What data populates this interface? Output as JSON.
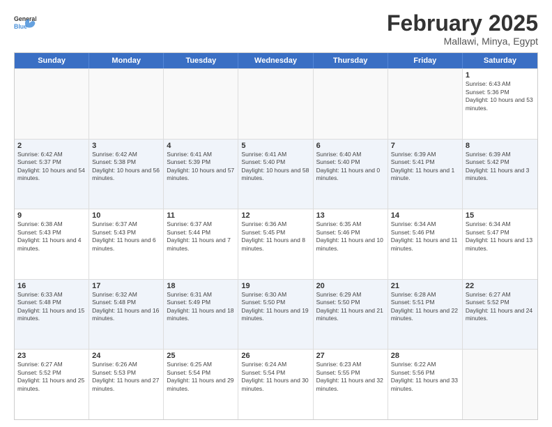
{
  "header": {
    "logo_general": "General",
    "logo_blue": "Blue",
    "title": "February 2025",
    "subtitle": "Mallawi, Minya, Egypt"
  },
  "days_of_week": [
    "Sunday",
    "Monday",
    "Tuesday",
    "Wednesday",
    "Thursday",
    "Friday",
    "Saturday"
  ],
  "weeks": [
    [
      {
        "day": "",
        "empty": true
      },
      {
        "day": "",
        "empty": true
      },
      {
        "day": "",
        "empty": true
      },
      {
        "day": "",
        "empty": true
      },
      {
        "day": "",
        "empty": true
      },
      {
        "day": "",
        "empty": true
      },
      {
        "day": "1",
        "sunrise": "Sunrise: 6:43 AM",
        "sunset": "Sunset: 5:36 PM",
        "daylight": "Daylight: 10 hours and 53 minutes."
      }
    ],
    [
      {
        "day": "2",
        "sunrise": "Sunrise: 6:42 AM",
        "sunset": "Sunset: 5:37 PM",
        "daylight": "Daylight: 10 hours and 54 minutes."
      },
      {
        "day": "3",
        "sunrise": "Sunrise: 6:42 AM",
        "sunset": "Sunset: 5:38 PM",
        "daylight": "Daylight: 10 hours and 56 minutes."
      },
      {
        "day": "4",
        "sunrise": "Sunrise: 6:41 AM",
        "sunset": "Sunset: 5:39 PM",
        "daylight": "Daylight: 10 hours and 57 minutes."
      },
      {
        "day": "5",
        "sunrise": "Sunrise: 6:41 AM",
        "sunset": "Sunset: 5:40 PM",
        "daylight": "Daylight: 10 hours and 58 minutes."
      },
      {
        "day": "6",
        "sunrise": "Sunrise: 6:40 AM",
        "sunset": "Sunset: 5:40 PM",
        "daylight": "Daylight: 11 hours and 0 minutes."
      },
      {
        "day": "7",
        "sunrise": "Sunrise: 6:39 AM",
        "sunset": "Sunset: 5:41 PM",
        "daylight": "Daylight: 11 hours and 1 minute."
      },
      {
        "day": "8",
        "sunrise": "Sunrise: 6:39 AM",
        "sunset": "Sunset: 5:42 PM",
        "daylight": "Daylight: 11 hours and 3 minutes."
      }
    ],
    [
      {
        "day": "9",
        "sunrise": "Sunrise: 6:38 AM",
        "sunset": "Sunset: 5:43 PM",
        "daylight": "Daylight: 11 hours and 4 minutes."
      },
      {
        "day": "10",
        "sunrise": "Sunrise: 6:37 AM",
        "sunset": "Sunset: 5:43 PM",
        "daylight": "Daylight: 11 hours and 6 minutes."
      },
      {
        "day": "11",
        "sunrise": "Sunrise: 6:37 AM",
        "sunset": "Sunset: 5:44 PM",
        "daylight": "Daylight: 11 hours and 7 minutes."
      },
      {
        "day": "12",
        "sunrise": "Sunrise: 6:36 AM",
        "sunset": "Sunset: 5:45 PM",
        "daylight": "Daylight: 11 hours and 8 minutes."
      },
      {
        "day": "13",
        "sunrise": "Sunrise: 6:35 AM",
        "sunset": "Sunset: 5:46 PM",
        "daylight": "Daylight: 11 hours and 10 minutes."
      },
      {
        "day": "14",
        "sunrise": "Sunrise: 6:34 AM",
        "sunset": "Sunset: 5:46 PM",
        "daylight": "Daylight: 11 hours and 11 minutes."
      },
      {
        "day": "15",
        "sunrise": "Sunrise: 6:34 AM",
        "sunset": "Sunset: 5:47 PM",
        "daylight": "Daylight: 11 hours and 13 minutes."
      }
    ],
    [
      {
        "day": "16",
        "sunrise": "Sunrise: 6:33 AM",
        "sunset": "Sunset: 5:48 PM",
        "daylight": "Daylight: 11 hours and 15 minutes."
      },
      {
        "day": "17",
        "sunrise": "Sunrise: 6:32 AM",
        "sunset": "Sunset: 5:48 PM",
        "daylight": "Daylight: 11 hours and 16 minutes."
      },
      {
        "day": "18",
        "sunrise": "Sunrise: 6:31 AM",
        "sunset": "Sunset: 5:49 PM",
        "daylight": "Daylight: 11 hours and 18 minutes."
      },
      {
        "day": "19",
        "sunrise": "Sunrise: 6:30 AM",
        "sunset": "Sunset: 5:50 PM",
        "daylight": "Daylight: 11 hours and 19 minutes."
      },
      {
        "day": "20",
        "sunrise": "Sunrise: 6:29 AM",
        "sunset": "Sunset: 5:50 PM",
        "daylight": "Daylight: 11 hours and 21 minutes."
      },
      {
        "day": "21",
        "sunrise": "Sunrise: 6:28 AM",
        "sunset": "Sunset: 5:51 PM",
        "daylight": "Daylight: 11 hours and 22 minutes."
      },
      {
        "day": "22",
        "sunrise": "Sunrise: 6:27 AM",
        "sunset": "Sunset: 5:52 PM",
        "daylight": "Daylight: 11 hours and 24 minutes."
      }
    ],
    [
      {
        "day": "23",
        "sunrise": "Sunrise: 6:27 AM",
        "sunset": "Sunset: 5:52 PM",
        "daylight": "Daylight: 11 hours and 25 minutes."
      },
      {
        "day": "24",
        "sunrise": "Sunrise: 6:26 AM",
        "sunset": "Sunset: 5:53 PM",
        "daylight": "Daylight: 11 hours and 27 minutes."
      },
      {
        "day": "25",
        "sunrise": "Sunrise: 6:25 AM",
        "sunset": "Sunset: 5:54 PM",
        "daylight": "Daylight: 11 hours and 29 minutes."
      },
      {
        "day": "26",
        "sunrise": "Sunrise: 6:24 AM",
        "sunset": "Sunset: 5:54 PM",
        "daylight": "Daylight: 11 hours and 30 minutes."
      },
      {
        "day": "27",
        "sunrise": "Sunrise: 6:23 AM",
        "sunset": "Sunset: 5:55 PM",
        "daylight": "Daylight: 11 hours and 32 minutes."
      },
      {
        "day": "28",
        "sunrise": "Sunrise: 6:22 AM",
        "sunset": "Sunset: 5:56 PM",
        "daylight": "Daylight: 11 hours and 33 minutes."
      },
      {
        "day": "",
        "empty": true
      }
    ]
  ]
}
